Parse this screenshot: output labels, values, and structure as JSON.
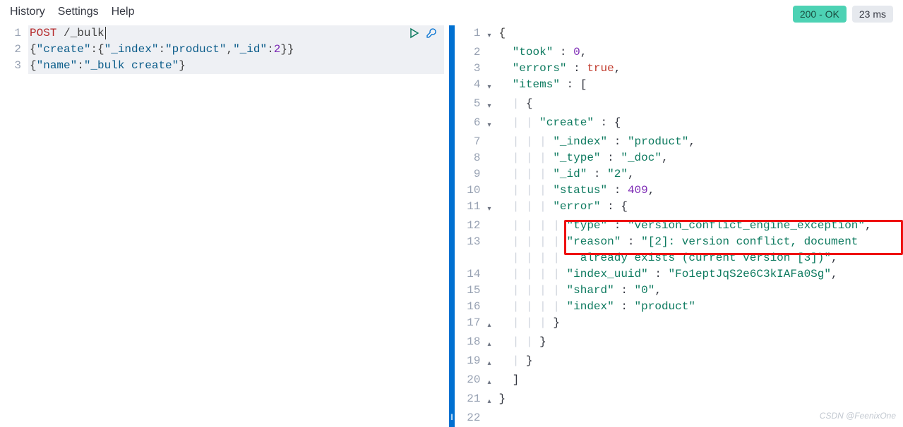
{
  "menu": {
    "history": "History",
    "settings": "Settings",
    "help": "Help"
  },
  "status": {
    "code": "200 - OK",
    "time": "23 ms"
  },
  "request": {
    "method": "POST",
    "path": "/_bulk",
    "body_line2_raw": "{\"create\":{\"_index\":\"product\",\"_id\":2}}",
    "body_line3_raw": "{\"name\":\"_bulk create\"}"
  },
  "response": {
    "took": 0,
    "errors": true,
    "items": [
      {
        "create": {
          "_index": "product",
          "_type": "_doc",
          "_id": "2",
          "status": 409,
          "error": {
            "type": "version_conflict_engine_exception",
            "reason": "[2]: version conflict, document already exists (current version [3])",
            "index_uuid": "Fo1eptJqS2e6C3kIAFa0Sg",
            "shard": "0",
            "index": "product"
          }
        }
      }
    ]
  },
  "resp_lines": {
    "l1": "{",
    "l2a": "\"took\"",
    "l2b": "0",
    "l3a": "\"errors\"",
    "l3b": "true",
    "l4a": "\"items\"",
    "l6a": "\"create\"",
    "l7a": "\"_index\"",
    "l7b": "\"product\"",
    "l8a": "\"_type\"",
    "l8b": "\"_doc\"",
    "l9a": "\"_id\"",
    "l9b": "\"2\"",
    "l10a": "\"status\"",
    "l10b": "409",
    "l11a": "\"error\"",
    "l12a": "\"type\"",
    "l12b": "\"version_conflict_engine_exception\"",
    "l13a": "\"reason\"",
    "l13b": "\"[2]: version conflict, document ",
    "l13c": "already exists (current version [3])\"",
    "l14a": "\"index_uuid\"",
    "l14b": "\"Fo1eptJqS2e6C3kIAFa0Sg\"",
    "l15a": "\"shard\"",
    "l15b": "\"0\"",
    "l16a": "\"index\"",
    "l16b": "\"product\""
  },
  "watermark": "CSDN @FeenixOne"
}
